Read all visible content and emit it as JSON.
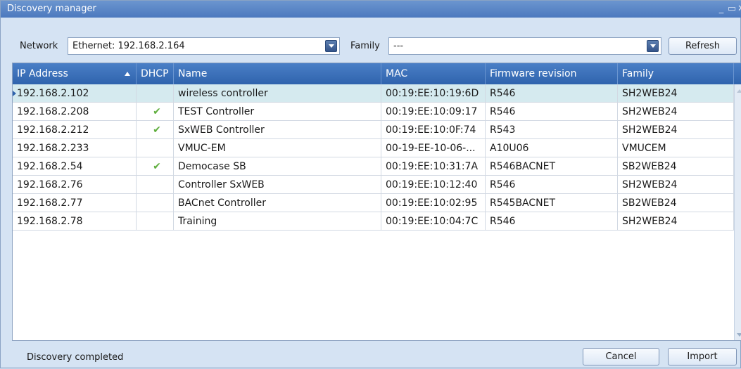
{
  "window": {
    "title": "Discovery manager"
  },
  "toolbar": {
    "network_label": "Network",
    "network_value": "Ethernet: 192.168.2.164",
    "family_label": "Family",
    "family_value": "---",
    "refresh_label": "Refresh"
  },
  "table": {
    "columns": [
      "IP Address",
      "DHCP",
      "Name",
      "MAC",
      "Firmware revision",
      "Family"
    ],
    "sort_column": "IP Address",
    "sort_direction": "ascending",
    "rows": [
      {
        "ip": "192.168.2.102",
        "dhcp": false,
        "name": "wireless controller",
        "mac": "00:19:EE:10:19:6D",
        "firmware": "R546",
        "family": "SH2WEB24"
      },
      {
        "ip": "192.168.2.208",
        "dhcp": true,
        "name": "TEST Controller",
        "mac": "00:19:EE:10:09:17",
        "firmware": "R546",
        "family": "SH2WEB24"
      },
      {
        "ip": "192.168.2.212",
        "dhcp": true,
        "name": "SxWEB Controller",
        "mac": "00:19:EE:10:0F:74",
        "firmware": "R543",
        "family": "SH2WEB24"
      },
      {
        "ip": "192.168.2.233",
        "dhcp": false,
        "name": "VMUC-EM",
        "mac": "00-19-EE-10-06-...",
        "firmware": "A10U06",
        "family": "VMUCEM"
      },
      {
        "ip": "192.168.2.54",
        "dhcp": true,
        "name": "Democase SB",
        "mac": "00:19:EE:10:31:7A",
        "firmware": "R546BACNET",
        "family": "SB2WEB24"
      },
      {
        "ip": "192.168.2.76",
        "dhcp": false,
        "name": "Controller SxWEB",
        "mac": "00:19:EE:10:12:40",
        "firmware": "R546",
        "family": "SH2WEB24"
      },
      {
        "ip": "192.168.2.77",
        "dhcp": false,
        "name": "BACnet Controller",
        "mac": "00:19:EE:10:02:95",
        "firmware": "R545BACNET",
        "family": "SB2WEB24"
      },
      {
        "ip": "192.168.2.78",
        "dhcp": false,
        "name": "Training",
        "mac": "00:19:EE:10:04:7C",
        "firmware": "R546",
        "family": "SH2WEB24"
      }
    ],
    "selected_row": 0
  },
  "status": {
    "text": "Discovery completed",
    "cancel_label": "Cancel",
    "import_label": "Import"
  },
  "colors": {
    "header_bg": "#2f63ad",
    "selected_row": "#d5eaef",
    "check": "#5fae3d"
  }
}
